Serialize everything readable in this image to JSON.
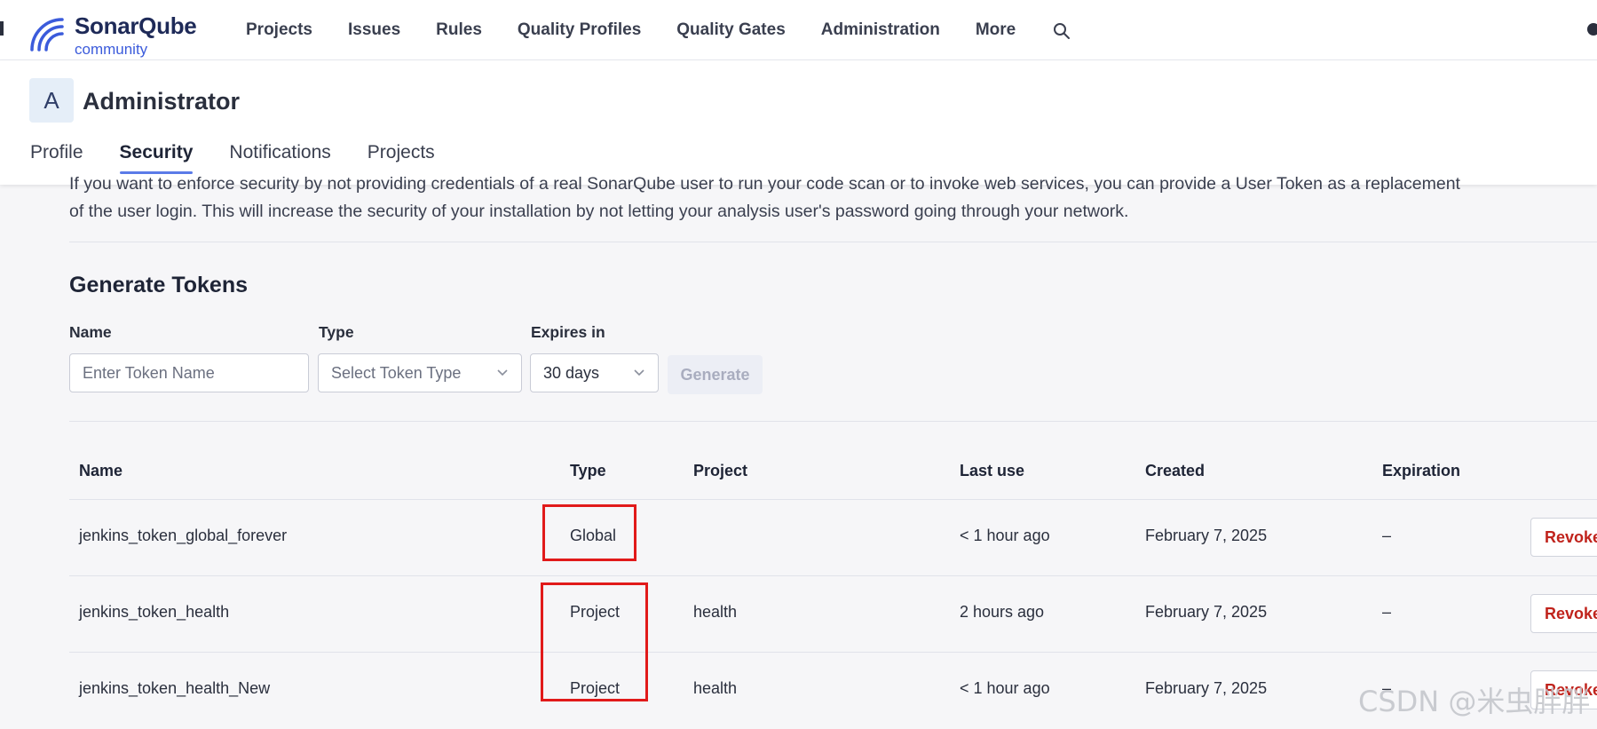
{
  "app": {
    "brand": "SonarQube",
    "brand_sub": "community",
    "nav": [
      "Projects",
      "Issues",
      "Rules",
      "Quality Profiles",
      "Quality Gates",
      "Administration",
      "More"
    ],
    "accent": "#3b5bdb"
  },
  "user": {
    "avatar_letter": "A",
    "name": "Administrator",
    "tabs": [
      "Profile",
      "Security",
      "Notifications",
      "Projects"
    ],
    "active_tab": "Security"
  },
  "intro": {
    "line1": "If you want to enforce security by not providing credentials of a real SonarQube user to run your code scan or to invoke web services, you can provide a User Token as a replacement",
    "line2": "of the user login. This will increase the security of your installation by not letting your analysis user's password going through your network."
  },
  "generate": {
    "title": "Generate Tokens",
    "name_label": "Name",
    "name_placeholder": "Enter Token Name",
    "type_label": "Type",
    "type_placeholder": "Select Token Type",
    "expires_label": "Expires in",
    "expires_value": "30 days",
    "button": "Generate"
  },
  "table": {
    "headers": [
      "Name",
      "Type",
      "Project",
      "Last use",
      "Created",
      "Expiration"
    ],
    "rows": [
      {
        "name": "jenkins_token_global_forever",
        "type": "Global",
        "project": "",
        "last_use": "< 1 hour ago",
        "created": "February 7, 2025",
        "expiration": "–",
        "action": "Revoke"
      },
      {
        "name": "jenkins_token_health",
        "type": "Project",
        "project": "health",
        "last_use": "2 hours ago",
        "created": "February 7, 2025",
        "expiration": "–",
        "action": "Revoke"
      },
      {
        "name": "jenkins_token_health_New",
        "type": "Project",
        "project": "health",
        "last_use": "< 1 hour ago",
        "created": "February 7, 2025",
        "expiration": "–",
        "action": "Revoke"
      }
    ]
  },
  "watermark": "CSDN @米虫胖胖",
  "colors": {
    "revoke": "#c0231c",
    "highlight": "#e11a1a",
    "tab_underline": "#5b7be8"
  }
}
